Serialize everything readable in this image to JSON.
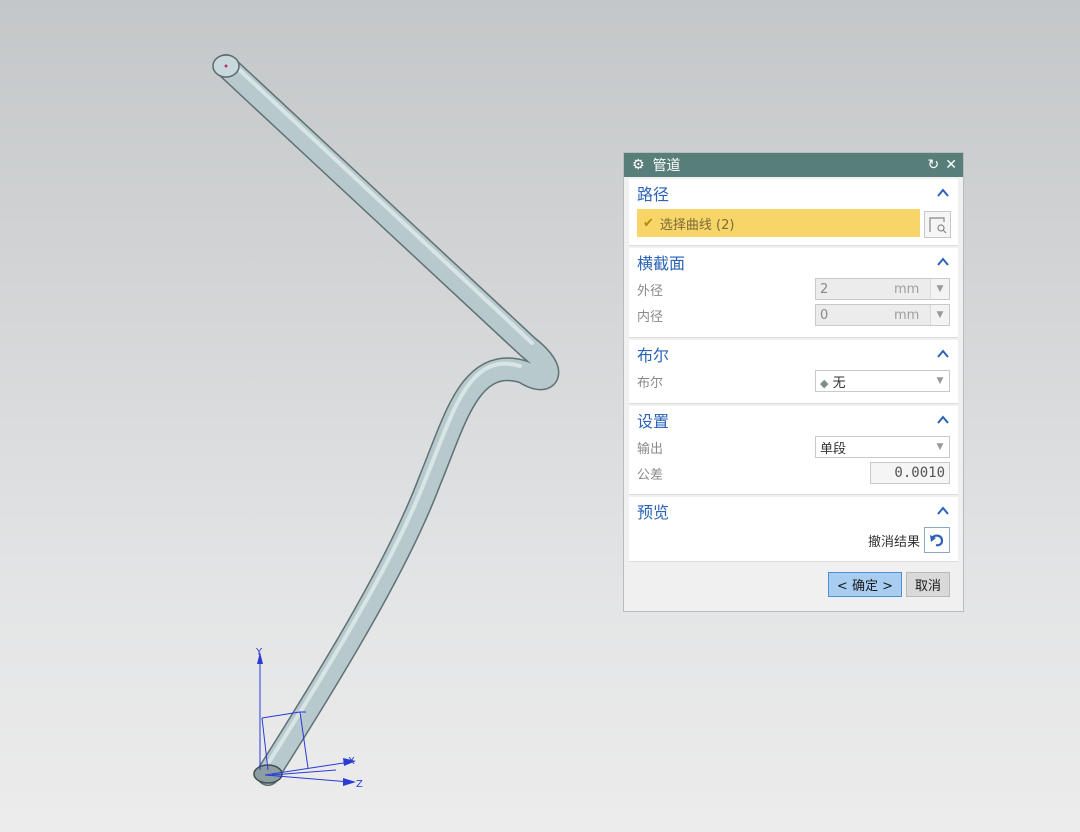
{
  "dialog": {
    "title": "管道",
    "gear_icon": "gear-icon",
    "reset_icon": "reset-icon",
    "close_icon": "close-icon",
    "sections": {
      "path": {
        "header": "路径",
        "select_curve_label": "选择曲线 (2)",
        "checkmark": "✔"
      },
      "cross_section": {
        "header": "横截面",
        "outer_label": "外径",
        "outer_value": "2",
        "outer_unit": "mm",
        "inner_label": "内径",
        "inner_value": "0",
        "inner_unit": "mm"
      },
      "boolean": {
        "header": "布尔",
        "label": "布尔",
        "value": "无"
      },
      "settings": {
        "header": "设置",
        "output_label": "输出",
        "output_value": "单段",
        "tolerance_label": "公差",
        "tolerance_value": "0.0010"
      },
      "preview": {
        "header": "预览",
        "undo_label": "撤消结果"
      }
    },
    "ok_label": "< 确定 >",
    "cancel_label": "取消"
  },
  "triad": {
    "x_label": "X",
    "y_label": "Y",
    "z_label": "Z"
  },
  "colors": {
    "titlebar": "#587e7a",
    "section_header": "#2a63b8",
    "selection_highlight": "#f7d568",
    "pipe": "#aec3c6",
    "axis": "#2a3bd6"
  }
}
